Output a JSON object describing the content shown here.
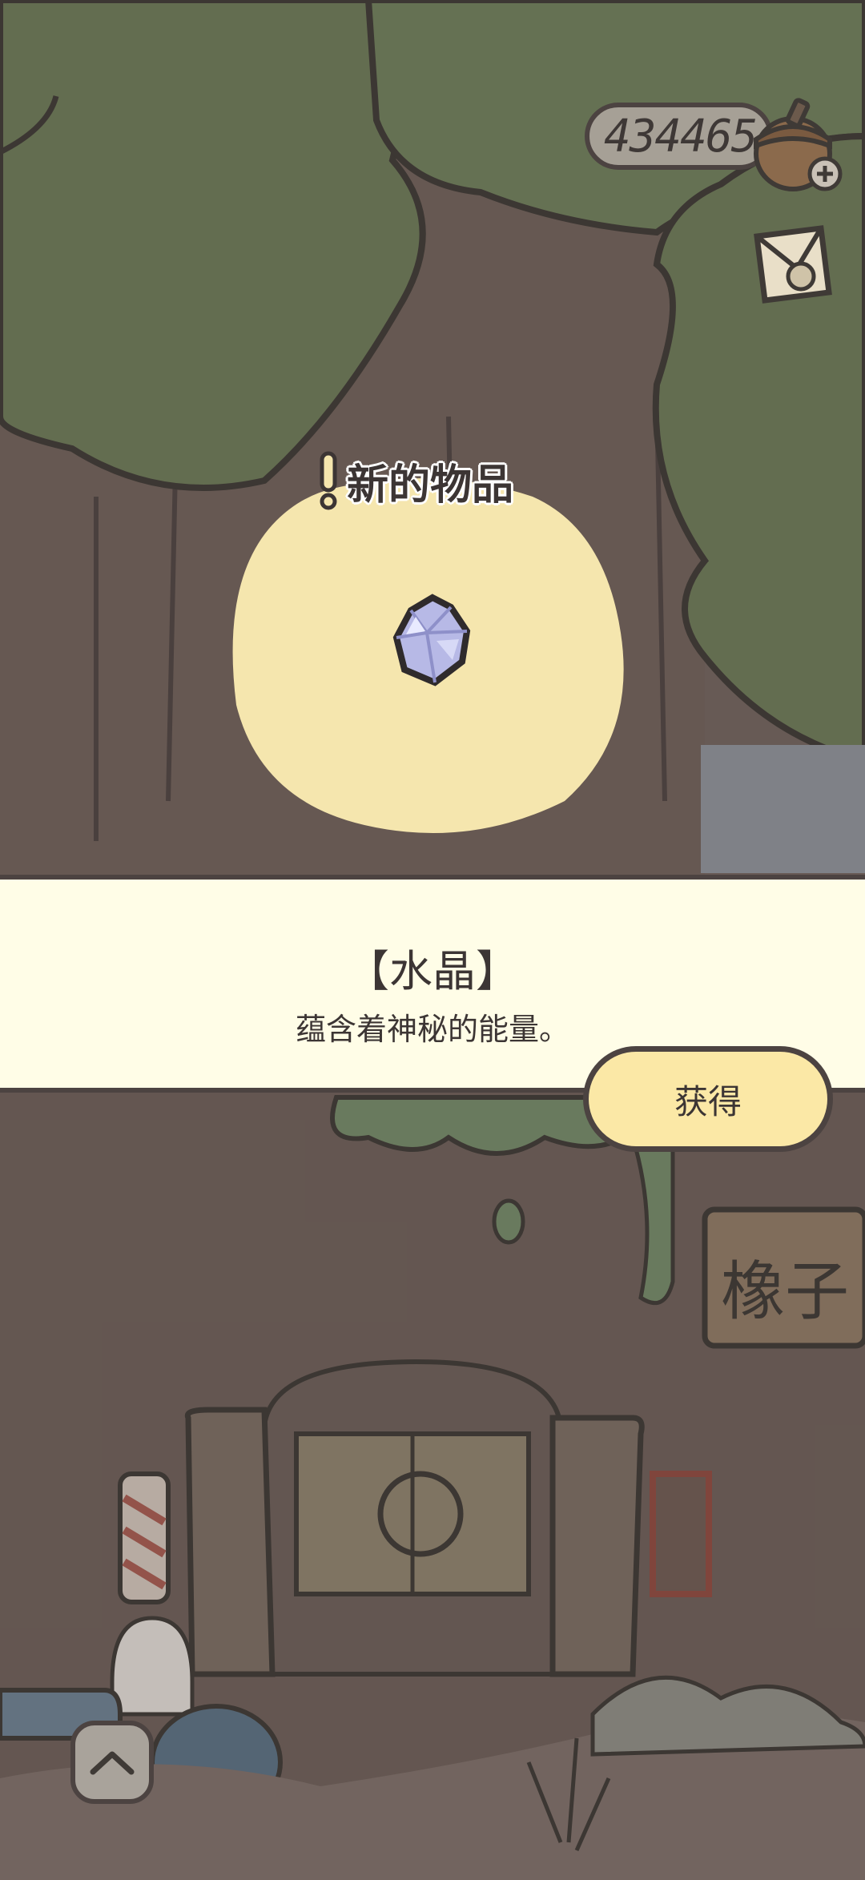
{
  "hud": {
    "acorn_count": "434465",
    "icons": [
      "acorn-icon",
      "plus-icon",
      "letter-icon",
      "exclaim-icon",
      "crystal-icon",
      "chevron-up-icon"
    ]
  },
  "new_item": {
    "header": "新的物品"
  },
  "item_panel": {
    "name": "【水晶】",
    "description": "蕴含着神秘的能量。",
    "obtain_label": "获得"
  },
  "colors": {
    "panel_bg": "#fffde7",
    "button_bg": "#fbe8a6",
    "outline": "#4c4341",
    "highlight": "#f5e6ae",
    "tree_green": "#6b7b5b"
  }
}
